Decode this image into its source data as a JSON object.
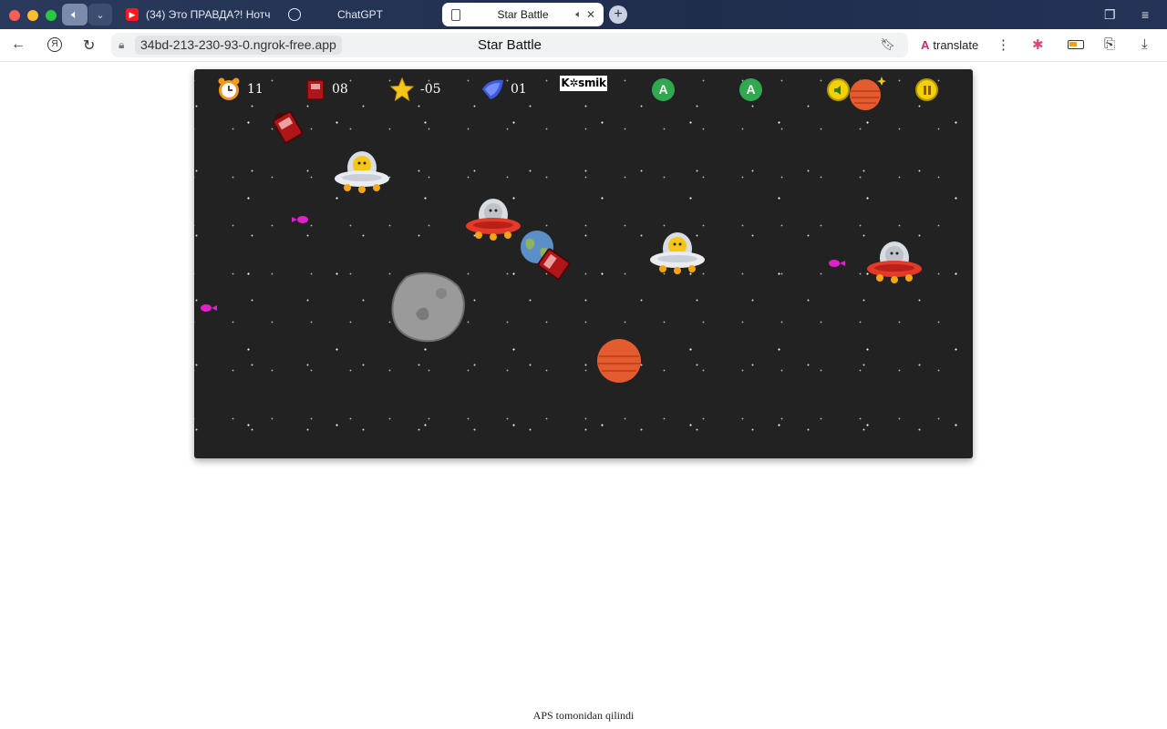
{
  "browser": {
    "tabs": [
      {
        "label": "(34) Это ПРАВДА?! Нотч /",
        "icon": "youtube-icon"
      },
      {
        "label": "ChatGPT",
        "icon": "chatgpt-icon"
      },
      {
        "label": "Star Battle",
        "icon": "page-icon",
        "active": true,
        "audio": true
      }
    ],
    "url": "34bd-213-230-93-0.ngrok-free.app",
    "page_title": "Star Battle",
    "translate_label": "translate"
  },
  "game": {
    "hud": {
      "timer": "11",
      "fuel": "08",
      "stars": "-05",
      "rockets": "01",
      "logo": "K✲smik"
    },
    "colors": {
      "space": "#222223",
      "hud_text": "#ffffff",
      "green_button": "#2fa84f",
      "yellow_button": "#f2d10a"
    }
  },
  "footer": {
    "text": "APS tomonidan qilindi"
  }
}
